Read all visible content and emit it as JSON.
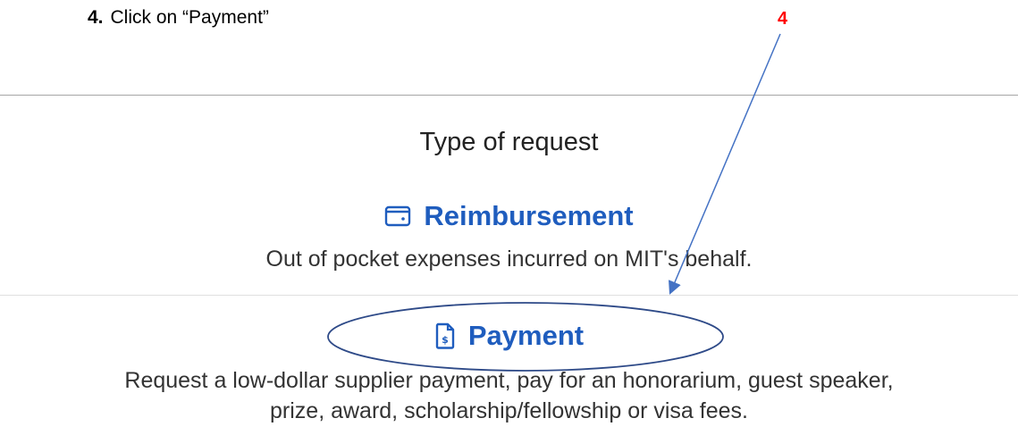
{
  "instruction": {
    "step_number": "4.",
    "text": "Click on “Payment”",
    "marker": "4"
  },
  "form": {
    "title": "Type of request",
    "options": [
      {
        "label": "Reimbursement",
        "icon": "wallet-icon",
        "description": "Out of pocket expenses incurred on MIT's behalf."
      },
      {
        "label": "Payment",
        "icon": "receipt-dollar-icon",
        "description_line1": "Request a low-dollar supplier payment, pay for an honorarium, guest speaker,",
        "description_line2": "prize, award, scholarship/fellowship or visa fees."
      }
    ]
  },
  "colors": {
    "link": "#1f5dbe",
    "marker": "#ff0000",
    "annotation": "#4472c4"
  }
}
